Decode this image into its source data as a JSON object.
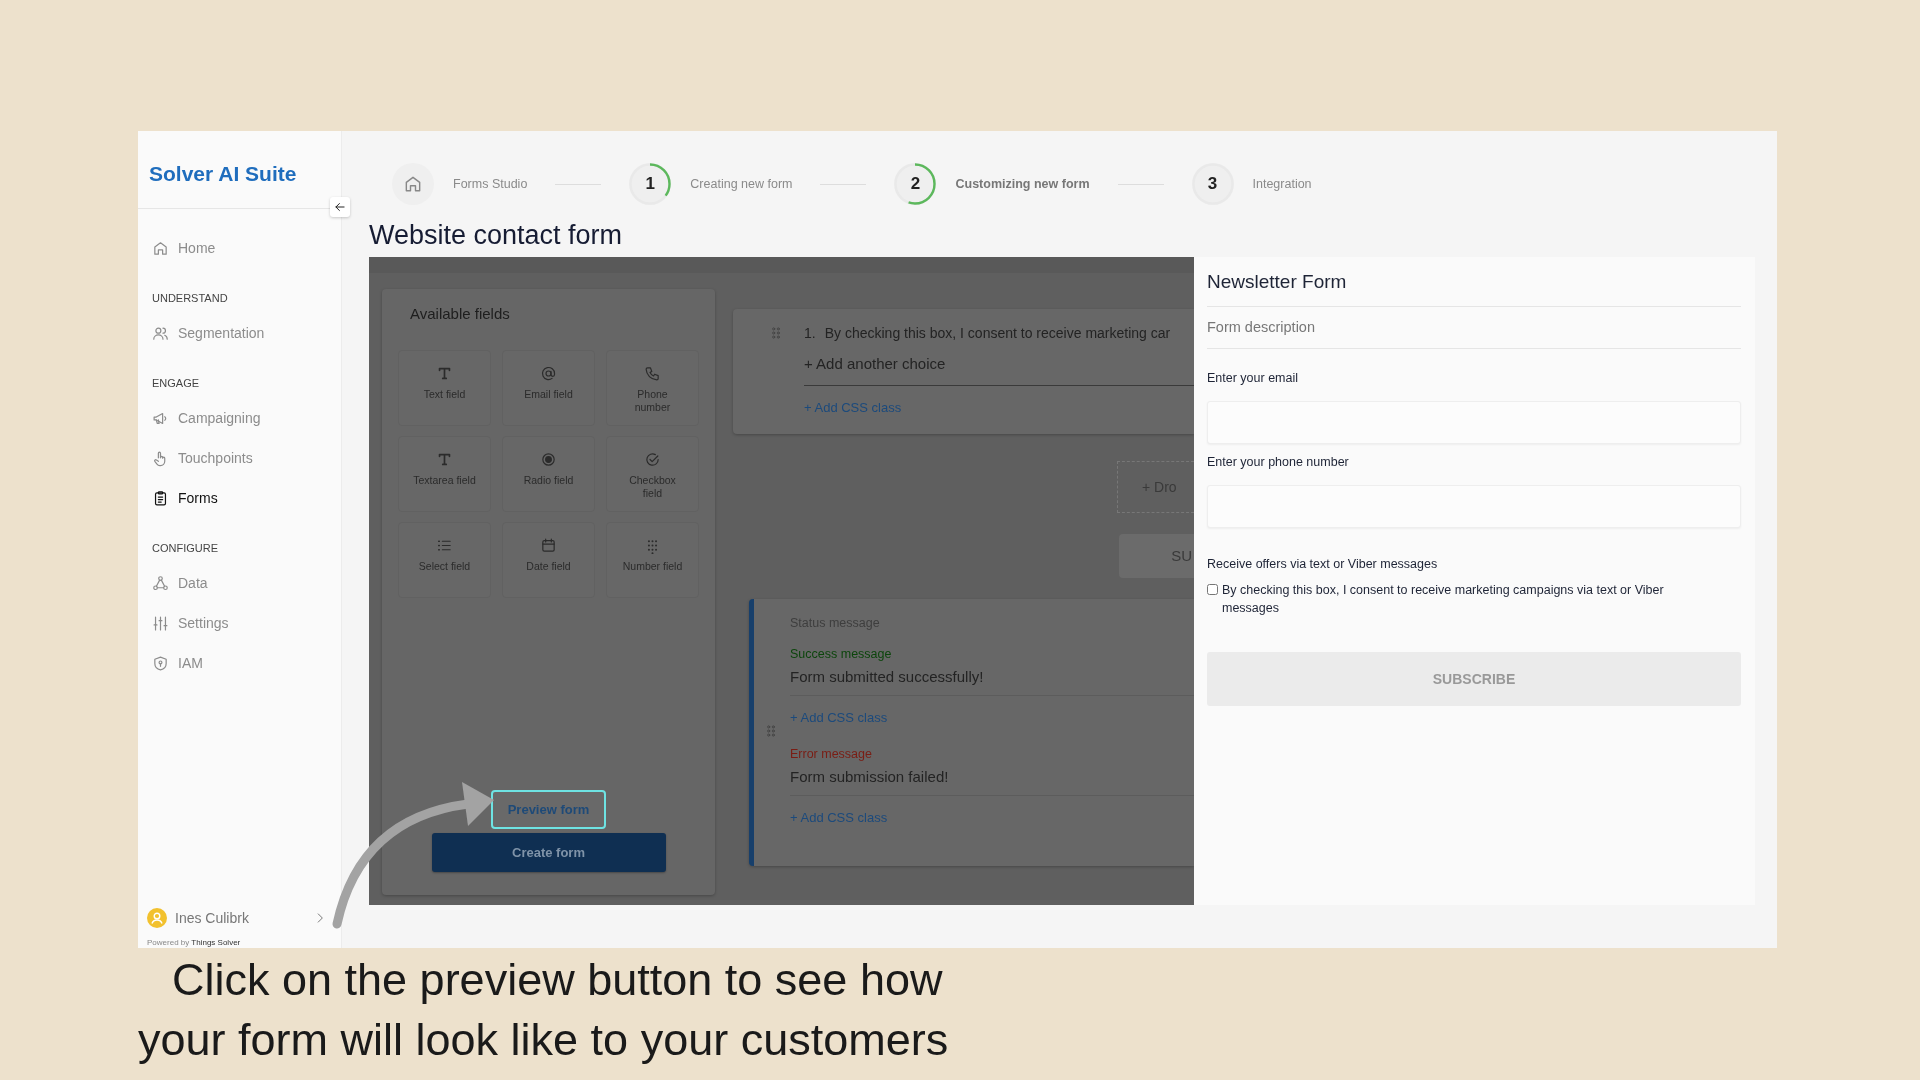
{
  "app": {
    "logo": "Solver AI Suite"
  },
  "sidebar": {
    "sections": [
      {
        "items": [
          {
            "label": "Home",
            "selected": false
          }
        ]
      },
      {
        "heading": "UNDERSTAND",
        "items": [
          {
            "label": "Segmentation",
            "selected": false
          }
        ]
      },
      {
        "heading": "ENGAGE",
        "items": [
          {
            "label": "Campaigning",
            "selected": false
          },
          {
            "label": "Touchpoints",
            "selected": false
          },
          {
            "label": "Forms",
            "selected": true
          }
        ]
      },
      {
        "heading": "CONFIGURE",
        "items": [
          {
            "label": "Data",
            "selected": false
          },
          {
            "label": "Settings",
            "selected": false
          },
          {
            "label": "IAM",
            "selected": false
          }
        ]
      }
    ],
    "user": {
      "name": "Ines Culibrk"
    },
    "footer": "Powered by **Things Solver**"
  },
  "stepper": [
    {
      "kind": "home",
      "label": "Forms Studio",
      "selected": false
    },
    {
      "kind": "number",
      "number": "1",
      "label": "Creating new form",
      "visited": true,
      "selected": false
    },
    {
      "kind": "number",
      "number": "2",
      "label": "Customizing new form",
      "visited": true,
      "selected": true
    },
    {
      "kind": "number",
      "number": "3",
      "label": "Integration",
      "visited": false,
      "selected": false
    }
  ],
  "page_title": "Website contact form",
  "available_fields": {
    "title": "Available fields",
    "items": [
      {
        "label": "Text field"
      },
      {
        "label": "Email field"
      },
      {
        "label": "Phone number"
      },
      {
        "label": "Textarea field"
      },
      {
        "label": "Radio field"
      },
      {
        "label": "Checkbox field"
      },
      {
        "label": "Select field"
      },
      {
        "label": "Date field"
      },
      {
        "label": "Number field"
      }
    ]
  },
  "actions": {
    "preview": {
      "label": "Preview form",
      "highlighted": true
    },
    "create": {
      "label": "Create form"
    }
  },
  "canvas": {
    "choice_card": {
      "number": "1.",
      "choice": "By checking this box, I consent to receive marketing car",
      "add_choice": "+ Add another choice",
      "add_css": "+ Add CSS class"
    },
    "drop_zone": "+ Dro",
    "submit_button": "SU",
    "status_card": {
      "title": "Status message",
      "messages": [
        {
          "kind": "success",
          "label": "Success message",
          "text": "Form submitted successfully!",
          "add_css": "+ Add CSS class"
        },
        {
          "kind": "error",
          "label": "Error message",
          "text": "Form submission failed!",
          "add_css": "+ Add CSS class"
        }
      ]
    }
  },
  "preview": {
    "title": "Newsletter Form",
    "description": "Form description",
    "fields": [
      {
        "kind": "input",
        "label": "Enter your email"
      },
      {
        "kind": "input",
        "label": "Enter your phone number"
      },
      {
        "kind": "checkbox",
        "label": "Receive offers via text or Viber messages",
        "option": "By checking this box, I consent to receive marketing campaigns via text or Viber messages",
        "checked": false
      }
    ],
    "button": "SUBSCRIBE"
  },
  "caption": [
    "Click on the preview button to see how",
    "your form will look like to your customers"
  ]
}
